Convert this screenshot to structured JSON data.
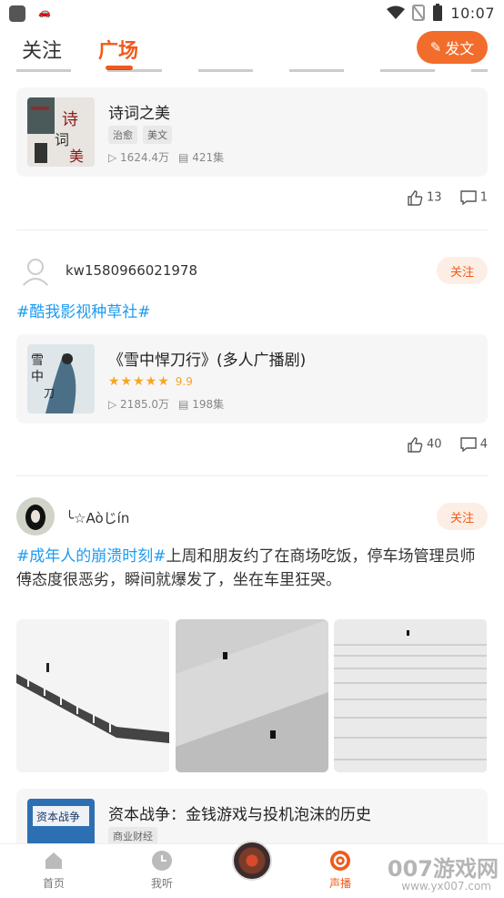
{
  "status_bar": {
    "time": "10:07"
  },
  "header": {
    "tabs": [
      {
        "label": "关注",
        "active": false
      },
      {
        "label": "广场",
        "active": true
      }
    ],
    "post_button": "发文",
    "accent": "#f05a1a"
  },
  "feed": {
    "post1": {
      "album": {
        "title": "诗词之美",
        "tags": [
          "治愈",
          "美文"
        ],
        "plays": "1624.4万",
        "episodes": "421集"
      },
      "likes": "13",
      "comments": "1"
    },
    "post2": {
      "username": "kw1580966021978",
      "follow_label": "关注",
      "hashtag": "#酷我影视种草社#",
      "album": {
        "title": "《雪中悍刀行》(多人广播剧)",
        "rating": "9.9",
        "stars": 5,
        "plays": "2185.0万",
        "episodes": "198集"
      },
      "likes": "40",
      "comments": "4"
    },
    "post3": {
      "username": "╰☆Aòじín",
      "follow_label": "关注",
      "hashtag": "#成年人的崩溃时刻#",
      "text": "上周和朋友约了在商场吃饭，停车场管理员师傅态度很恶劣，瞬间就爆发了，坐在车里狂哭。",
      "album": {
        "title": "资本战争：金钱游戏与投机泡沫的历史",
        "tags": [
          "商业财经"
        ]
      }
    }
  },
  "bottom_nav": {
    "items": [
      {
        "label": "首页",
        "icon": "home-icon"
      },
      {
        "label": "我听",
        "icon": "clock-icon"
      },
      {
        "label": "",
        "icon": "now-playing-disc"
      },
      {
        "label": "声播",
        "icon": "broadcast-icon",
        "active": true
      }
    ]
  },
  "watermark": {
    "text": "007游戏网",
    "url": "www.yx007.com"
  }
}
